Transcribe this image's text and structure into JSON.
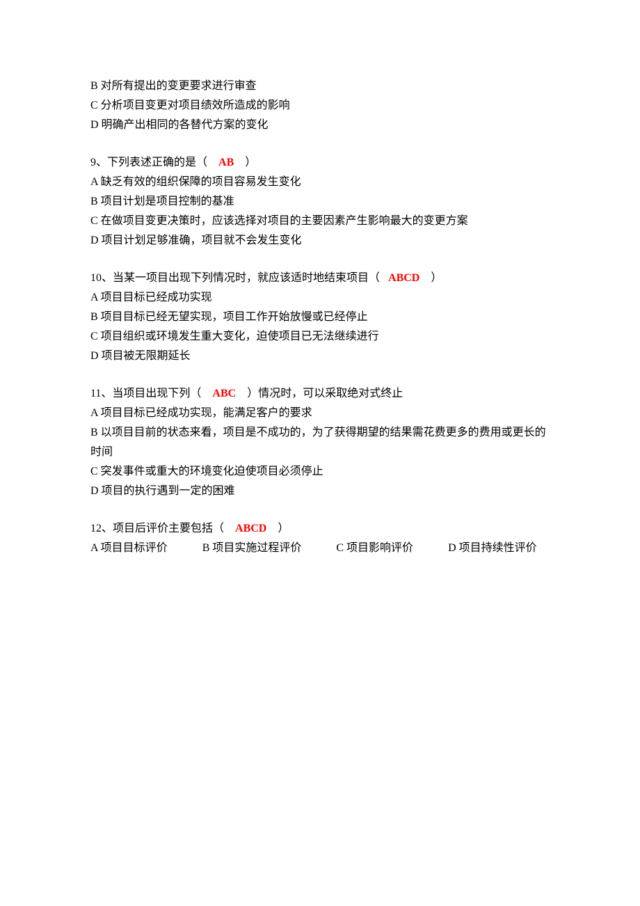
{
  "q8_tail": {
    "optB": "B 对所有提出的变更要求进行审查",
    "optC": "C 分析项目变更对项目绩效所造成的影响",
    "optD": "D 明确产出相同的各替代方案的变化"
  },
  "q9": {
    "stem_pre": "9、下列表述正确的是（",
    "answer": "AB",
    "stem_post": "）",
    "optA": "A 缺乏有效的组织保障的项目容易发生变化",
    "optB": "B 项目计划是项目控制的基准",
    "optC": "C 在做项目变更决策时，应该选择对项目的主要因素产生影响最大的变更方案",
    "optD": "D 项目计划足够准确，项目就不会发生变化"
  },
  "q10": {
    "stem_pre": "10、当某一项目出现下列情况时，就应该适时地结束项目（",
    "answer": "ABCD",
    "stem_post": "）",
    "optA": "A 项目目标已经成功实现",
    "optB": "B 项目目标已经无望实现，项目工作开始放慢或已经停止",
    "optC": "C 项目组织或环境发生重大变化，迫使项目已无法继续进行",
    "optD": "D 项目被无限期延长"
  },
  "q11": {
    "stem_pre": "11、当项目出现下列（",
    "answer": "ABC",
    "stem_post": "）情况时，可以采取绝对式终止",
    "optA": "A 项目目标已经成功实现，能满足客户的要求",
    "optB": "B 以项目目前的状态来看，项目是不成功的，为了获得期望的结果需花费更多的费用或更长的时间",
    "optC": "C 突发事件或重大的环境变化迫使项目必须停止",
    "optD": "D 项目的执行遇到一定的困难"
  },
  "q12": {
    "stem_pre": "12、项目后评价主要包括（",
    "answer": "ABCD",
    "stem_post": "）",
    "optA": "A 项目目标评价",
    "optB": "B 项目实施过程评价",
    "optC": "C 项目影响评价",
    "optD": "D 项目持续性评价"
  }
}
